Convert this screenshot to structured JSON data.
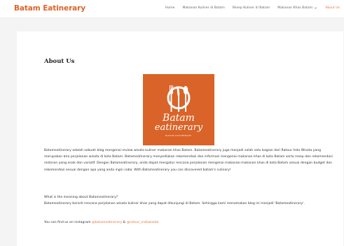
{
  "header": {
    "logo": "Batam Eatinerary",
    "nav": [
      {
        "label": "Home"
      },
      {
        "label": "Makanan Kuliner di Batam"
      },
      {
        "label": "Resep Kuliner di Batam"
      },
      {
        "label": "Makanan Khas Batam"
      },
      {
        "label": "About Us"
      }
    ]
  },
  "page": {
    "title": "About Us",
    "image": {
      "line1": "Batam",
      "line2": "eatinerary",
      "tagline": "BATAM EATINERARY"
    },
    "paragraph1": "Batameatinerary adalah sebuah blog mengenai review wisata kuliner makanan khas Batam. Batameatinerary juga menjadi salah satu bagian dari Ratour Indo Wisata yang merupakan biro perjalanan wisata di kota Batam. Batameatinerary menyediakan rekomendasi dan informasi mengenai makanan khas di kota Batam serta resep dan rekomendasi restoran yang enak dan variatif. Dengan Batameatinerary, anda dapat mengatur rencana perjalanan mengenai makanan-makanan khas di kota Batam sesuai dengan budget dan rekomendasi sesuai dengan apa yang anda ingin coba. With Batameatinerary you can discovered batam's culinary!",
    "paragraph2_line1": "What is the meaning about Batameatinerary?",
    "paragraph2_line2": "Batameatinerary berarti rencana perjalanan wisata kuliner khas yang dapat dikunjungi di Batam. Sehingga kami menamakan blog ini menjadi 'Batameatinerary'.",
    "contact_prefix": "You can find us on instagram ",
    "contact_link1": "@batameatinerary",
    "contact_amp": " & ",
    "contact_link2": "@ratour_indowisata"
  },
  "colors": {
    "brand": "#e0642a",
    "image_bg": "#d96328",
    "link": "#e8743b"
  },
  "icons": [
    "fork-icon",
    "knife-icon",
    "spoon-icon",
    "plate-icon",
    "chevron-down-icon"
  ]
}
